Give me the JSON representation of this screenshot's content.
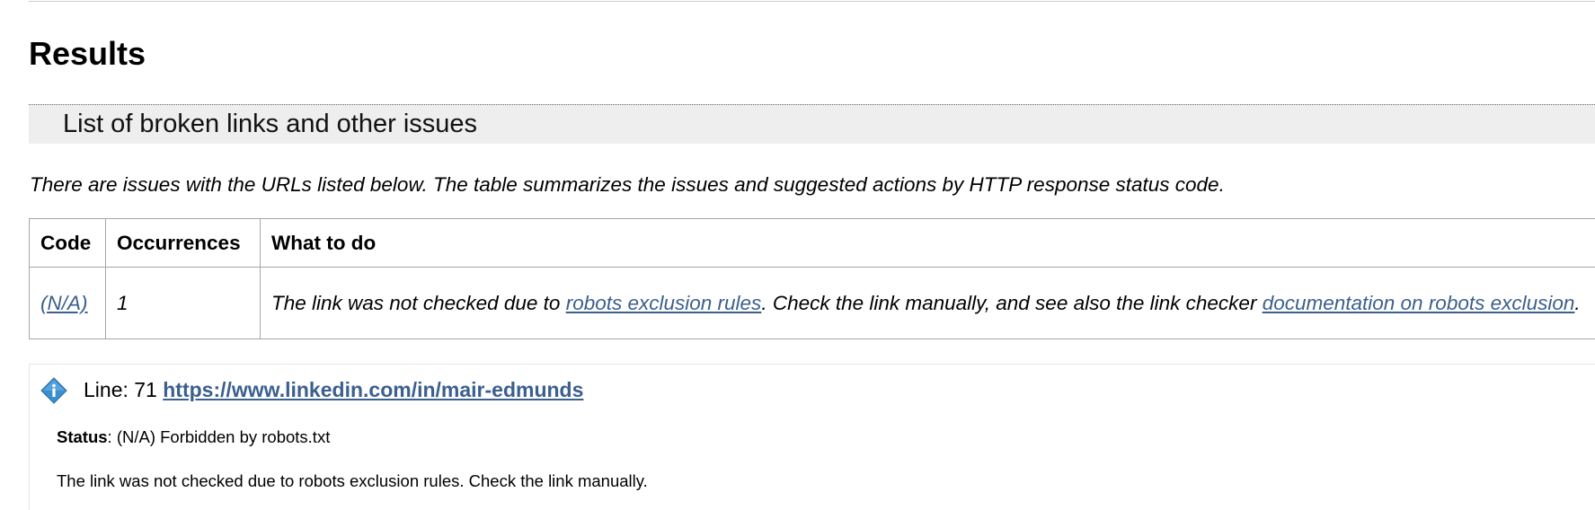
{
  "page": {
    "heading": "Results",
    "section_title": "List of broken links and other issues",
    "summary_text": "There are issues with the URLs listed below. The table summarizes the issues and suggested actions by HTTP response status code."
  },
  "table": {
    "headers": {
      "code": "Code",
      "occurrences": "Occurrences",
      "what_to_do": "What to do"
    },
    "rows": [
      {
        "code": "(N/A)",
        "occurrences": "1",
        "text_before": "The link was not checked due to ",
        "link1": "robots exclusion rules",
        "text_middle": ". Check the link manually, and see also the link checker ",
        "link2": "documentation on robots exclusion",
        "text_after": "."
      }
    ]
  },
  "detail": {
    "icon": "info-diamond-icon",
    "line_label": "Line: 71",
    "url": "https://www.linkedin.com/in/mair-edmunds",
    "status_label": "Status",
    "status_value": ": (N/A) Forbidden by robots.txt",
    "message": "The link was not checked due to robots exclusion rules. Check the link manually."
  },
  "colors": {
    "link": "#3b5f8e",
    "section_bg": "#eeeeee",
    "icon": "#3a8fd0"
  }
}
